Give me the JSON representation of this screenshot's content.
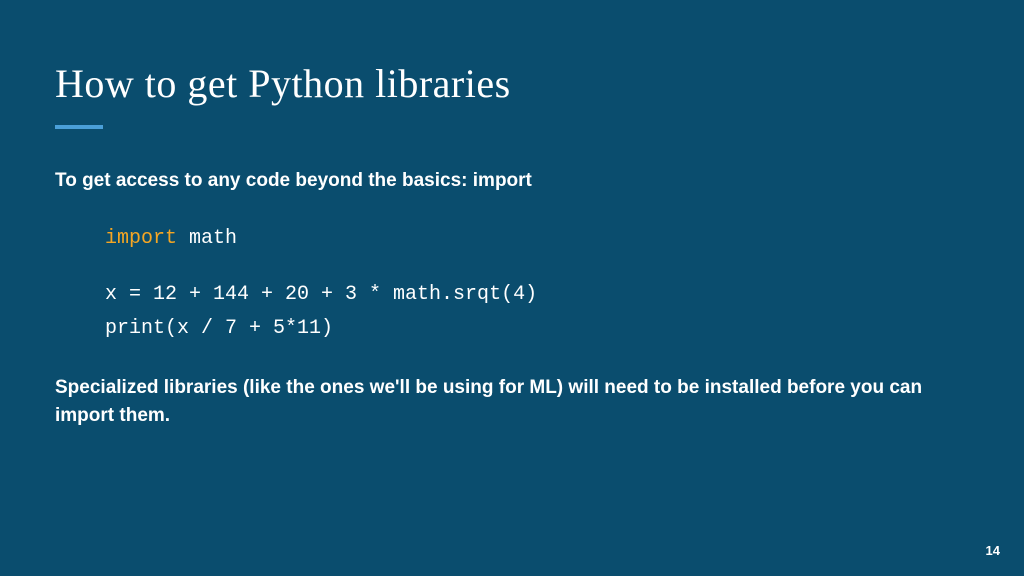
{
  "title": "How to get Python libraries",
  "intro": "To get access to any code beyond the basics: import",
  "code": {
    "line1_keyword": "import",
    "line1_rest": " math",
    "line2": "x = 12 + 144 + 20 + 3 * math.srqt(4)",
    "line3": "print(x / 7 + 5*11)"
  },
  "outro": "Specialized libraries (like the ones we'll be using for ML) will need to be installed before you can import them.",
  "page_number": "14"
}
